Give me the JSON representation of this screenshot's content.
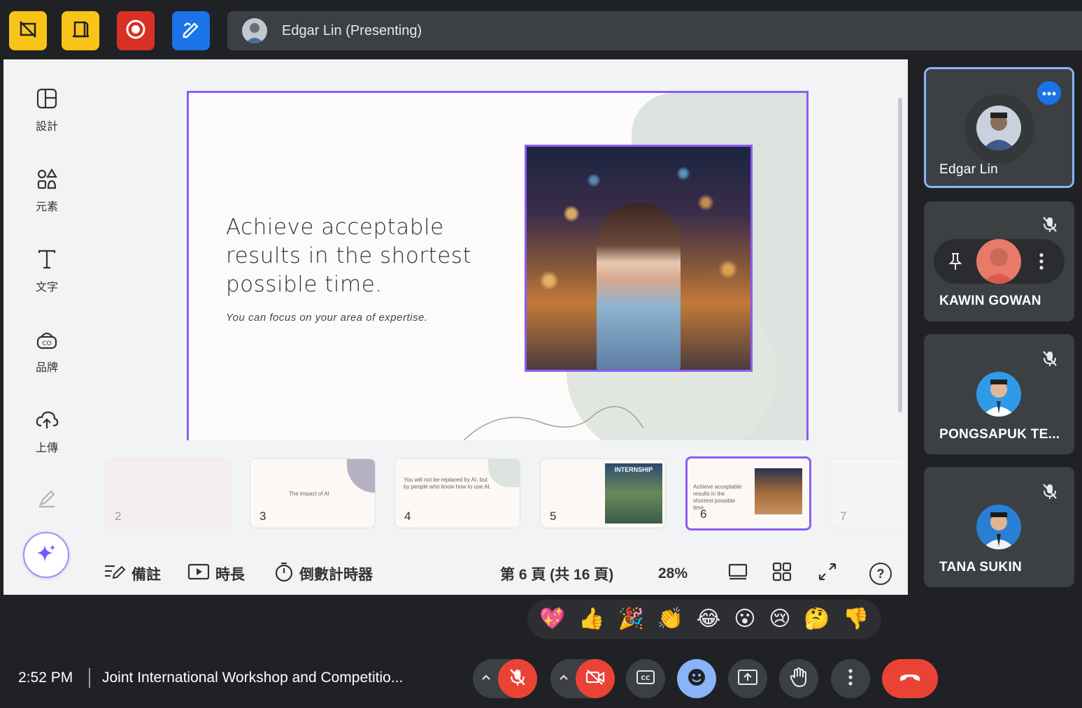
{
  "topbar": {
    "buttons": [
      {
        "name": "hide-slides-icon",
        "color": "#f9c418"
      },
      {
        "name": "door-icon",
        "color": "#f9c418"
      },
      {
        "name": "record-icon",
        "color": "#d93025"
      },
      {
        "name": "annotate-icon",
        "color": "#1a73e8"
      }
    ],
    "presenter": "Edgar Lin (Presenting)"
  },
  "sidebar": {
    "items": [
      {
        "label": "設計",
        "icon": "layout-icon"
      },
      {
        "label": "元素",
        "icon": "shapes-icon"
      },
      {
        "label": "文字",
        "icon": "text-icon"
      },
      {
        "label": "品牌",
        "icon": "brand-icon"
      },
      {
        "label": "上傳",
        "icon": "cloud-upload-icon"
      }
    ]
  },
  "slide": {
    "title": "Achieve acceptable results in the shortest possible time.",
    "subtitle": "You can focus on your area of expertise."
  },
  "thumbnails": [
    {
      "num": "2",
      "text": ""
    },
    {
      "num": "3",
      "text": "The impact of AI"
    },
    {
      "num": "4",
      "text": "You will not be replaced by AI, but by people who know how to use AI."
    },
    {
      "num": "5",
      "text": "INTERNSHIP"
    },
    {
      "num": "6",
      "text": "Achieve acceptable results in the shortest possible time."
    },
    {
      "num": "7",
      "text": ""
    }
  ],
  "bottombar": {
    "notes": "備註",
    "duration": "時長",
    "timer": "倒數計時器",
    "page_status": "第 6 頁 (共 16 頁)",
    "zoom": "28%",
    "help": "?"
  },
  "participants": [
    {
      "name": "Edgar Lin"
    },
    {
      "name": "KAWIN GOWAN"
    },
    {
      "name": "PONGSAPUK TE..."
    },
    {
      "name": "TANA SUKIN"
    }
  ],
  "reactions": [
    "💖",
    "👍",
    "🎉",
    "👏",
    "😂",
    "😮",
    "😢",
    "🤔",
    "👎"
  ],
  "footer": {
    "time": "2:52 PM",
    "meeting_title": "Joint International Workshop and Competitio..."
  },
  "colors": {
    "accent": "#8b5cf6",
    "danger": "#ea4335",
    "active_blue": "#8ab4f8"
  }
}
